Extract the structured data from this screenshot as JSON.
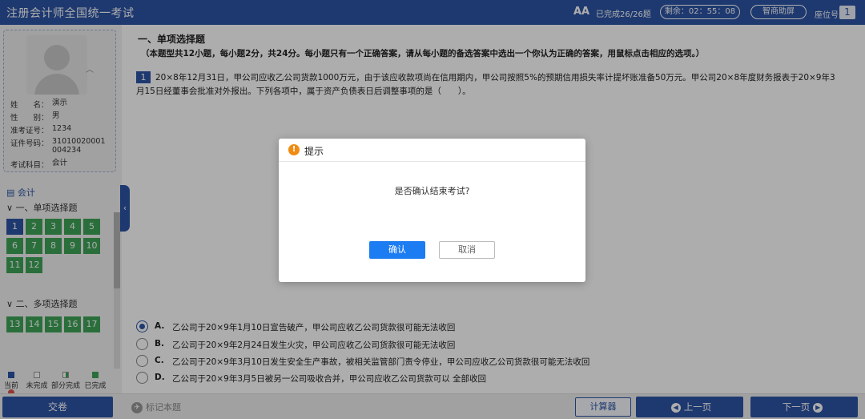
{
  "header": {
    "title": "注册会计师全国统一考试",
    "font_icon": "AA",
    "progress": "已完成26/26题",
    "timer": "剩余：02：55：08",
    "screen_button": "智商助屏",
    "seat_label": "座位号",
    "seat_number": "1"
  },
  "candidate": {
    "rows": [
      {
        "key": "姓　　名：",
        "value": "演示"
      },
      {
        "key": "性　　别：",
        "value": "男"
      },
      {
        "key": "准考证号：",
        "value": "1234"
      },
      {
        "key": "证件号码：",
        "value": "31010020001004234"
      },
      {
        "key": "考试科目：",
        "value": "会计"
      }
    ]
  },
  "nav": {
    "subject": "会计",
    "section1": "一、单项选择题",
    "section1_questions": [
      "1",
      "2",
      "3",
      "4",
      "5",
      "6",
      "7",
      "8",
      "9",
      "10",
      "11",
      "12"
    ],
    "section2": "二、多项选择题",
    "section2_questions": [
      "13",
      "14",
      "15",
      "16",
      "17"
    ],
    "legend": [
      "当前",
      "未完成",
      "部分完成",
      "已完成",
      "标记"
    ]
  },
  "question": {
    "section_title": "一、单项选择题",
    "section_desc": "（本题型共12小题，每小题2分，共24分。每小题只有一个正确答案，请从每小题的备选答案中选出一个你认为正确的答案，用鼠标点击相应的选项。）",
    "number": "1",
    "text": "20×8年12月31日，甲公司应收乙公司货款1000万元，由于该应收款项尚在信用期内，甲公司按照5%的预期信用损失率计提坏账准备50万元。甲公司20×8年度财务报表于20×9年3月15日经董事会批准对外报出。下列各项中，属于资产负债表日后调整事项的是（　　）。",
    "options": [
      {
        "letter": "A.",
        "text": "乙公司于20×9年1月10日宣告破产，甲公司应收乙公司货款很可能无法收回",
        "selected": true
      },
      {
        "letter": "B.",
        "text": "乙公司于20×9年2月24日发生火灾，甲公司应收乙公司货款很可能无法收回",
        "selected": false
      },
      {
        "letter": "C.",
        "text": "乙公司于20×9年3月10日发生安全生产事故，被相关监管部门责令停业，甲公司应收乙公司货款很可能无法收回",
        "selected": false
      },
      {
        "letter": "D.",
        "text": "乙公司于20×9年3月5日被另一公司吸收合并，甲公司应收乙公司货款可以 全部收回",
        "selected": false
      }
    ]
  },
  "footer": {
    "submit": "交卷",
    "mark": "标记本题",
    "calculator": "计算器",
    "prev": "上一页",
    "next": "下一页"
  },
  "dialog": {
    "title": "提示",
    "message": "是否确认结束考试?",
    "ok": "确认",
    "cancel": "取消"
  },
  "colors": {
    "primary": "#2d55a6",
    "done": "#3ea457",
    "dialog_ok": "#1c7cf2",
    "warn": "#f08c14"
  }
}
